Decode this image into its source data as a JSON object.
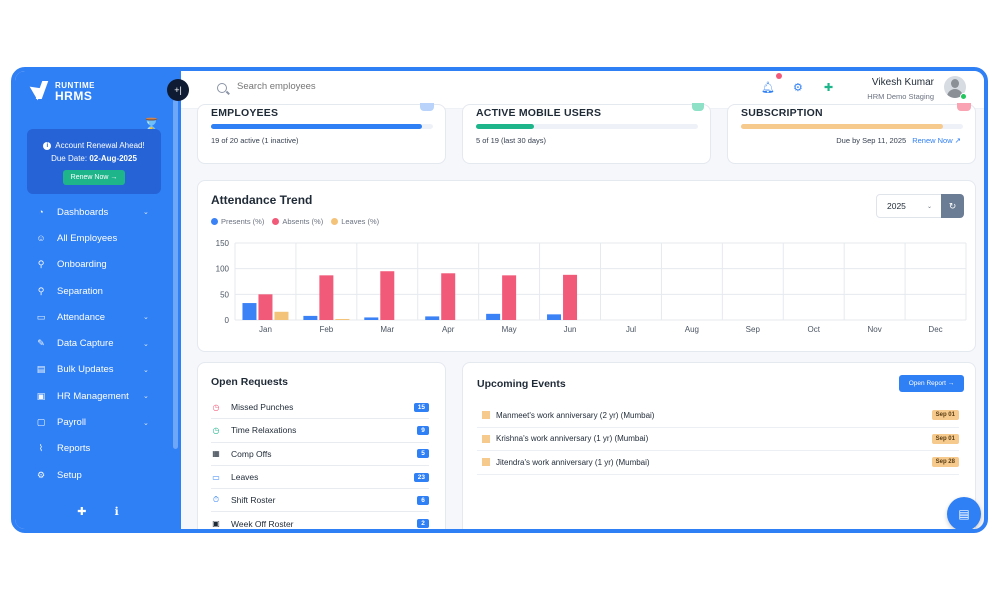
{
  "brand": {
    "line1": "RUNTIME",
    "line2": "HRMS"
  },
  "colors": {
    "primary": "#2f7ff5",
    "presents": "#3b82f6",
    "absents": "#f25a7a",
    "leaves": "#f3c37a",
    "success": "#1fb58a"
  },
  "collapse": {
    "label": "+|"
  },
  "renewal": {
    "title": "Account Renewal Ahead!",
    "due_label": "Due Date: ",
    "due_date": "02-Aug-2025",
    "button": "Renew Now →"
  },
  "sidebar": {
    "items": [
      {
        "label": "Dashboards",
        "icon": "dashboard-icon",
        "glyph": "◔",
        "chevron": true
      },
      {
        "label": "All Employees",
        "icon": "users-icon",
        "glyph": "☺",
        "chevron": false
      },
      {
        "label": "Onboarding",
        "icon": "user-plus-icon",
        "glyph": "⚲",
        "chevron": false
      },
      {
        "label": "Separation",
        "icon": "user-minus-icon",
        "glyph": "⚲",
        "chevron": false
      },
      {
        "label": "Attendance",
        "icon": "calendar-icon",
        "glyph": "▭",
        "chevron": true
      },
      {
        "label": "Data Capture",
        "icon": "pen-icon",
        "glyph": "✎",
        "chevron": true
      },
      {
        "label": "Bulk Updates",
        "icon": "file-icon",
        "glyph": "▤",
        "chevron": true
      },
      {
        "label": "HR Management",
        "icon": "briefcase-icon",
        "glyph": "▣",
        "chevron": true
      },
      {
        "label": "Payroll",
        "icon": "wallet-icon",
        "glyph": "▢",
        "chevron": true
      },
      {
        "label": "Reports",
        "icon": "chart-icon",
        "glyph": "⌇",
        "chevron": false
      },
      {
        "label": "Setup",
        "icon": "gear-icon",
        "glyph": "⚙",
        "chevron": false
      }
    ],
    "bottom_icons": [
      {
        "icon": "plugin-icon",
        "glyph": "✚"
      },
      {
        "icon": "info-icon",
        "glyph": "ℹ"
      }
    ]
  },
  "topbar": {
    "search_placeholder": "Search employees",
    "user_name": "Vikesh Kumar",
    "user_org": "HRM Demo Staging"
  },
  "stats": {
    "employees": {
      "title": "EMPLOYEES",
      "sub": "19 of 20 active (1 inactive)",
      "progress": 0.95
    },
    "mobile": {
      "title": "ACTIVE MOBILE USERS",
      "sub": "5 of 19 (last 30 days)",
      "progress": 0.26
    },
    "subscription": {
      "title": "SUBSCRIPTION",
      "sub": "Due by Sep 11, 2025",
      "link": "Renew Now ↗",
      "progress": 0.91
    }
  },
  "attendance": {
    "title": "Attendance Trend",
    "year": "2025",
    "legend": [
      "Presents (%)",
      "Absents (%)",
      "Leaves (%)"
    ]
  },
  "chart_data": {
    "type": "bar",
    "categories": [
      "Jan",
      "Feb",
      "Mar",
      "Apr",
      "May",
      "Jun",
      "Jul",
      "Aug",
      "Sep",
      "Oct",
      "Nov",
      "Dec"
    ],
    "series": [
      {
        "name": "Presents (%)",
        "values": [
          33,
          8,
          5,
          7,
          12,
          11,
          0,
          0,
          0,
          0,
          0,
          0
        ]
      },
      {
        "name": "Absents (%)",
        "values": [
          50,
          87,
          95,
          91,
          87,
          88,
          0,
          0,
          0,
          0,
          0,
          0
        ]
      },
      {
        "name": "Leaves (%)",
        "values": [
          16,
          2,
          0,
          0,
          0,
          0,
          0,
          0,
          0,
          0,
          0,
          0
        ]
      }
    ],
    "ylim": [
      0,
      150
    ],
    "yticks": [
      0,
      50,
      100,
      150
    ],
    "grid": true,
    "legend": "top-left"
  },
  "requests": {
    "title": "Open Requests",
    "items": [
      {
        "label": "Missed Punches",
        "count": "15",
        "icon": "clock-alert-icon",
        "glyph": "◷",
        "color": "#f25a7a"
      },
      {
        "label": "Time Relaxations",
        "count": "9",
        "icon": "clock-icon",
        "glyph": "◷",
        "color": "#1fb58a"
      },
      {
        "label": "Comp Offs",
        "count": "5",
        "icon": "calendar-plus-icon",
        "glyph": "▦",
        "color": "#1f2a37"
      },
      {
        "label": "Leaves",
        "count": "23",
        "icon": "calendar-icon",
        "glyph": "▭",
        "color": "#2f7ff5"
      },
      {
        "label": "Shift Roster",
        "count": "6",
        "icon": "stopwatch-icon",
        "glyph": "⏱",
        "color": "#2f7ff5"
      },
      {
        "label": "Week Off Roster",
        "count": "2",
        "icon": "calendar-off-icon",
        "glyph": "▣",
        "color": "#1f2a37"
      }
    ]
  },
  "events": {
    "title": "Upcoming Events",
    "button": "Open Report →",
    "items": [
      {
        "label": "Manmeet's work anniversary (2 yr) (Mumbai)",
        "date": "Sep 01"
      },
      {
        "label": "Krishna's work anniversary (1 yr) (Mumbai)",
        "date": "Sep 01"
      },
      {
        "label": "Jitendra's work anniversary (1 yr) (Mumbai)",
        "date": "Sep 28"
      }
    ]
  }
}
